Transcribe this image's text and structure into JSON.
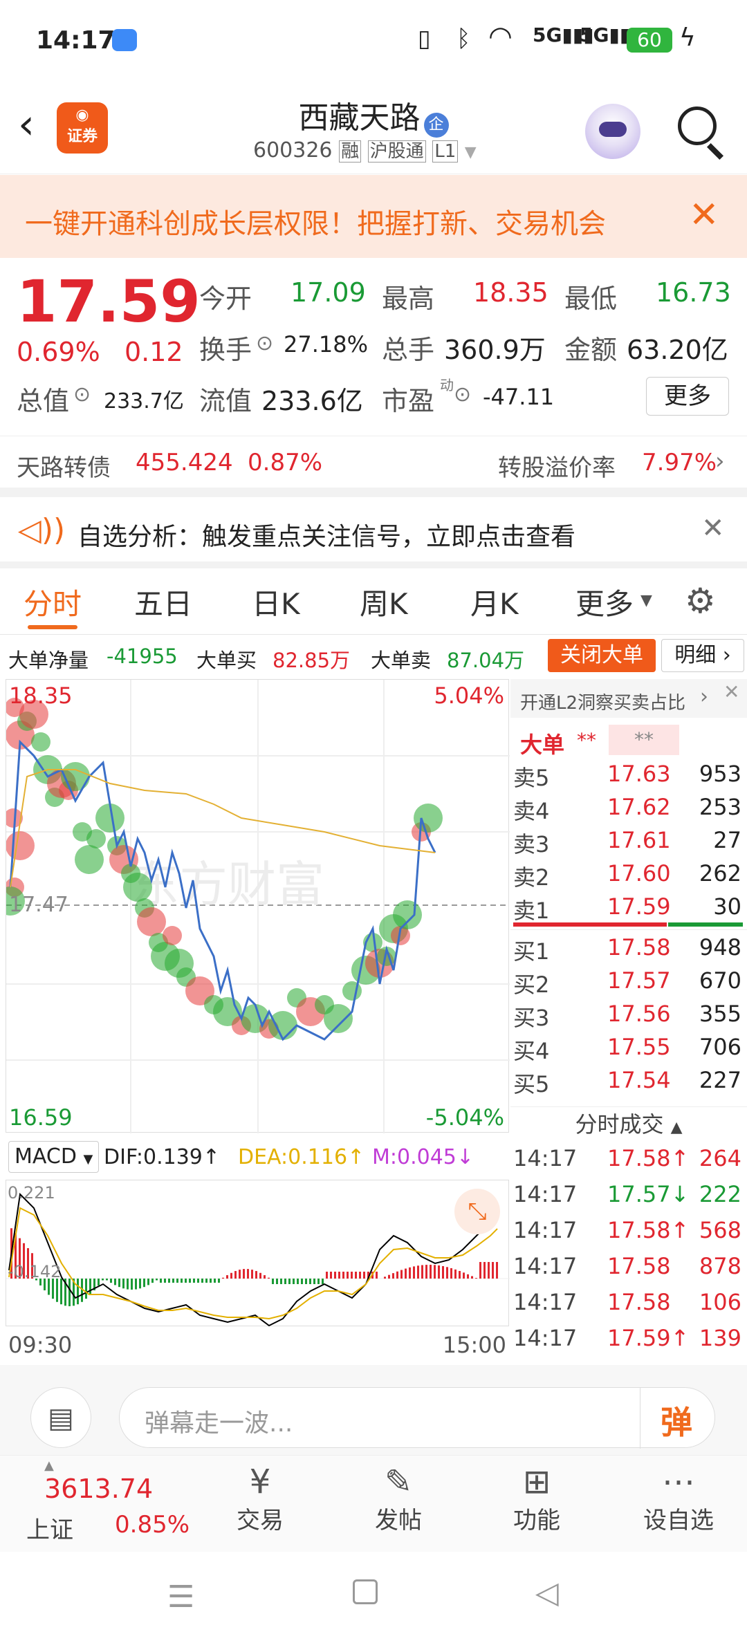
{
  "status": {
    "time": "14:17",
    "battery": "60"
  },
  "header": {
    "logo": "证券",
    "title": "西藏天路",
    "badge": "企",
    "code": "600326",
    "tags": [
      "融",
      "沪股通",
      "L1"
    ]
  },
  "banner": {
    "text": "一键开通科创成长层权限！把握打新、交易机会"
  },
  "quote": {
    "price": "17.59",
    "change_pct": "0.69%",
    "change": "0.12",
    "open_label": "今开",
    "open": "17.09",
    "high_label": "最高",
    "high": "18.35",
    "low_label": "最低",
    "low": "16.73",
    "turnover_label": "换手",
    "turnover": "27.18%",
    "volume_label": "总手",
    "volume": "360.9万",
    "amount_label": "金额",
    "amount": "63.20亿",
    "mktcap_label": "总值",
    "mktcap": "233.7亿",
    "float_label": "流值",
    "float": "233.6亿",
    "pe_label": "市盈",
    "pe_sup": "动",
    "pe": "-47.11",
    "more": "更多"
  },
  "bond": {
    "name": "天路转债",
    "price": "455.424",
    "pct": "0.87%",
    "premium_label": "转股溢价率",
    "premium": "7.97%"
  },
  "notice": {
    "text": "自选分析：触发重点关注信号，立即点击查看"
  },
  "tabs": [
    "分时",
    "五日",
    "日K",
    "周K",
    "月K",
    "更多"
  ],
  "bigorder": {
    "net_label": "大单净量",
    "net": "-41955",
    "buy_label": "大单买",
    "buy": "82.85万",
    "sell_label": "大单卖",
    "sell": "87.04万",
    "close_btn": "关闭大单",
    "detail_btn": "明细"
  },
  "chart": {
    "top_price": "18.35",
    "bottom_price": "16.59",
    "top_pct": "5.04%",
    "bottom_pct": "-5.04%",
    "ref_price": "17.47",
    "watermark": "东方财富"
  },
  "macd": {
    "label": "MACD",
    "dif": "DIF:0.139↑",
    "dea": "DEA:0.116↑",
    "m": "M:0.045↓",
    "top": "0.221",
    "bottom": "-0.142"
  },
  "times": {
    "start": "09:30",
    "end": "15:00"
  },
  "side": {
    "l2_link": "开通L2洞察买卖占比",
    "big_label": "大单",
    "stars1": "**",
    "stars2": "**",
    "sells": [
      {
        "label": "卖5",
        "price": "17.63",
        "vol": "953"
      },
      {
        "label": "卖4",
        "price": "17.62",
        "vol": "253"
      },
      {
        "label": "卖3",
        "price": "17.61",
        "vol": "27"
      },
      {
        "label": "卖2",
        "price": "17.60",
        "vol": "262"
      },
      {
        "label": "卖1",
        "price": "17.59",
        "vol": "30"
      }
    ],
    "buys": [
      {
        "label": "买1",
        "price": "17.58",
        "vol": "948"
      },
      {
        "label": "买2",
        "price": "17.57",
        "vol": "670"
      },
      {
        "label": "买3",
        "price": "17.56",
        "vol": "355"
      },
      {
        "label": "买4",
        "price": "17.55",
        "vol": "706"
      },
      {
        "label": "买5",
        "price": "17.54",
        "vol": "227"
      }
    ],
    "ticks_title": "分时成交",
    "ticks": [
      {
        "time": "14:17",
        "price": "17.58↑",
        "vol": "264",
        "color": "#e0262f"
      },
      {
        "time": "14:17",
        "price": "17.57↓",
        "vol": "222",
        "color": "#1a9a35"
      },
      {
        "time": "14:17",
        "price": "17.58↑",
        "vol": "568",
        "color": "#e0262f"
      },
      {
        "time": "14:17",
        "price": "17.58",
        "vol": "878",
        "color": "#e0262f"
      },
      {
        "time": "14:17",
        "price": "17.58",
        "vol": "106",
        "color": "#e0262f"
      },
      {
        "time": "14:17",
        "price": "17.59↑",
        "vol": "139",
        "color": "#e0262f"
      }
    ]
  },
  "comment": {
    "placeholder": "弹幕走一波...",
    "danmu": "弹"
  },
  "bottomnav": {
    "index_value": "3613.74",
    "index_name": "上证",
    "index_pct": "0.85%",
    "items": [
      "交易",
      "发帖",
      "功能",
      "设自选"
    ]
  }
}
